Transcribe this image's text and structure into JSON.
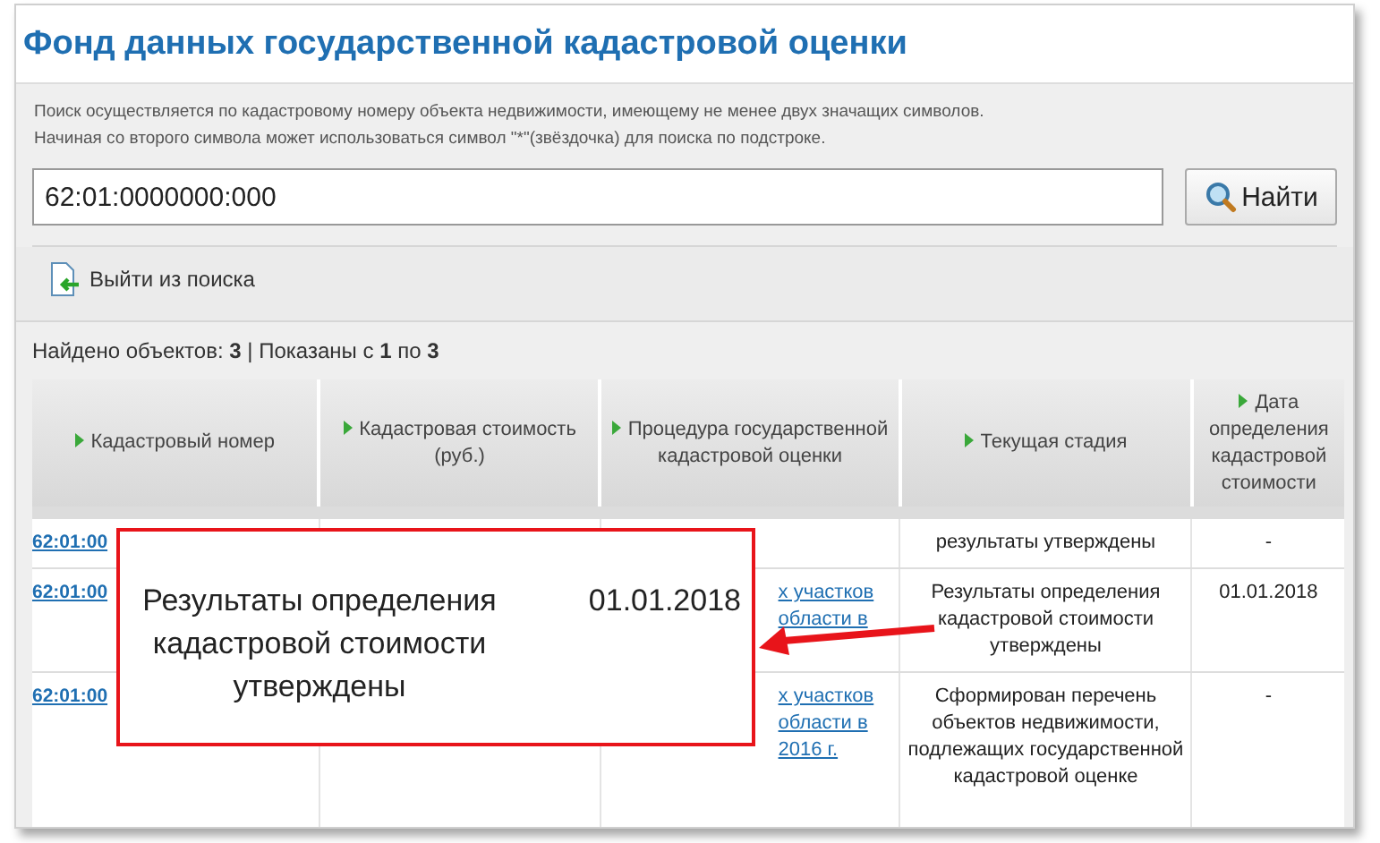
{
  "title": "Фонд данных государственной кадастровой оценки",
  "hints": [
    "Поиск осуществляется по кадастровому номеру объекта недвижимости, имеющему не менее двух значащих символов.",
    "Начиная со второго символа может использоваться символ \"*\"(звёздочка) для поиска по подстроке."
  ],
  "search": {
    "value": "62:01:0000000:000",
    "button": "Найти"
  },
  "exit_link": "Выйти из поиска",
  "found": "Найдено объектов: **3** | Показаны с **1** по **3**",
  "columns": [
    "Кадастровый номер",
    "Кадастровая стоимость (руб.)",
    "Процедура государственной кадастровой оценки",
    "Текущая стадия",
    "Дата определения кадастровой стоимости"
  ],
  "rows": [
    {
      "number": "62:01:00",
      "stage": "результаты утверждены",
      "date": "-"
    },
    {
      "number": "62:01:00",
      "procedure": [
        "х участков",
        "области в"
      ],
      "stage": "Результаты определения кадастровой стоимости утверждены",
      "date": "01.01.2018"
    },
    {
      "number": "62:01:00",
      "procedure": [
        "х участков",
        "области в",
        "2016 г."
      ],
      "stage": "Сформирован перечень объектов недвижимости, подлежащих государственной кадастровой оценке",
      "date": "-"
    }
  ],
  "callout": {
    "text": "Результаты определения кадастровой стоимости утверждены",
    "date": "01.01.2018"
  }
}
